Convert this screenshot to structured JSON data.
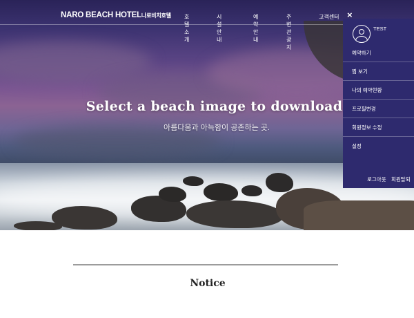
{
  "brand": {
    "name_en": "NARO BEACH HOTEL",
    "name_ko": "나로비치호텔"
  },
  "nav": {
    "items": [
      {
        "label": "호텔소개"
      },
      {
        "label": "시설안내"
      },
      {
        "label": "예약안내"
      },
      {
        "label": "주변관광지"
      },
      {
        "label": "고객센터"
      }
    ]
  },
  "hero": {
    "title": "Select a beach image to download.",
    "subtitle": "아름다움과 아늑함이 공존하는 곳."
  },
  "side_panel": {
    "close_icon": "×",
    "avatar_icon": "user-icon",
    "username": "TEST",
    "menu": [
      {
        "label": "예약하기"
      },
      {
        "label": "찜 보기"
      },
      {
        "label": "나의 예약현황"
      },
      {
        "label": "프로필변경"
      },
      {
        "label": "회원정보 수정"
      },
      {
        "label": "설정"
      }
    ],
    "logout_label": "로그아웃",
    "withdraw_label": "회원탈퇴"
  },
  "content": {
    "section_title": "Notice"
  },
  "colors": {
    "panel": "#2e2a6e",
    "divider": "#9c9c9c",
    "text": "#222222"
  }
}
